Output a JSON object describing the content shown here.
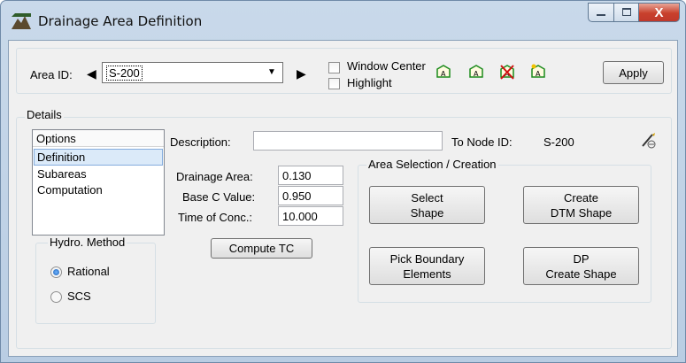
{
  "window": {
    "title": "Drainage Area Definition",
    "close_glyph": "X",
    "accent_close": "#c0392b"
  },
  "top": {
    "area_id_label": "Area ID:",
    "area_id_value": "S-200",
    "window_center_label": "Window Center",
    "highlight_label": "Highlight",
    "apply_label": "Apply"
  },
  "details": {
    "group_label": "Details",
    "options_header": "Options",
    "options": [
      "Definition",
      "Subareas",
      "Computation"
    ],
    "selected_option": "Definition",
    "description_label": "Description:",
    "description_value": "",
    "to_node_label": "To Node ID:",
    "to_node_value": "S-200",
    "drainage_area_label": "Drainage Area:",
    "drainage_area_value": "0.130",
    "base_c_label": "Base C Value:",
    "base_c_value": "0.950",
    "toc_label": "Time of Conc.:",
    "toc_value": "10.000",
    "compute_tc_label": "Compute TC"
  },
  "hydro": {
    "group_label": "Hydro. Method",
    "options": [
      "Rational",
      "SCS"
    ],
    "selected": "Rational"
  },
  "area_selection": {
    "group_label": "Area Selection / Creation",
    "select_shape_label": "Select\nShape",
    "create_dtm_label": "Create\nDTM Shape",
    "pick_boundary_label": "Pick Boundary\nElements",
    "dp_create_label": "DP\nCreate Shape"
  },
  "tool_icon_text": [
    "A",
    "A",
    "A",
    "A"
  ]
}
